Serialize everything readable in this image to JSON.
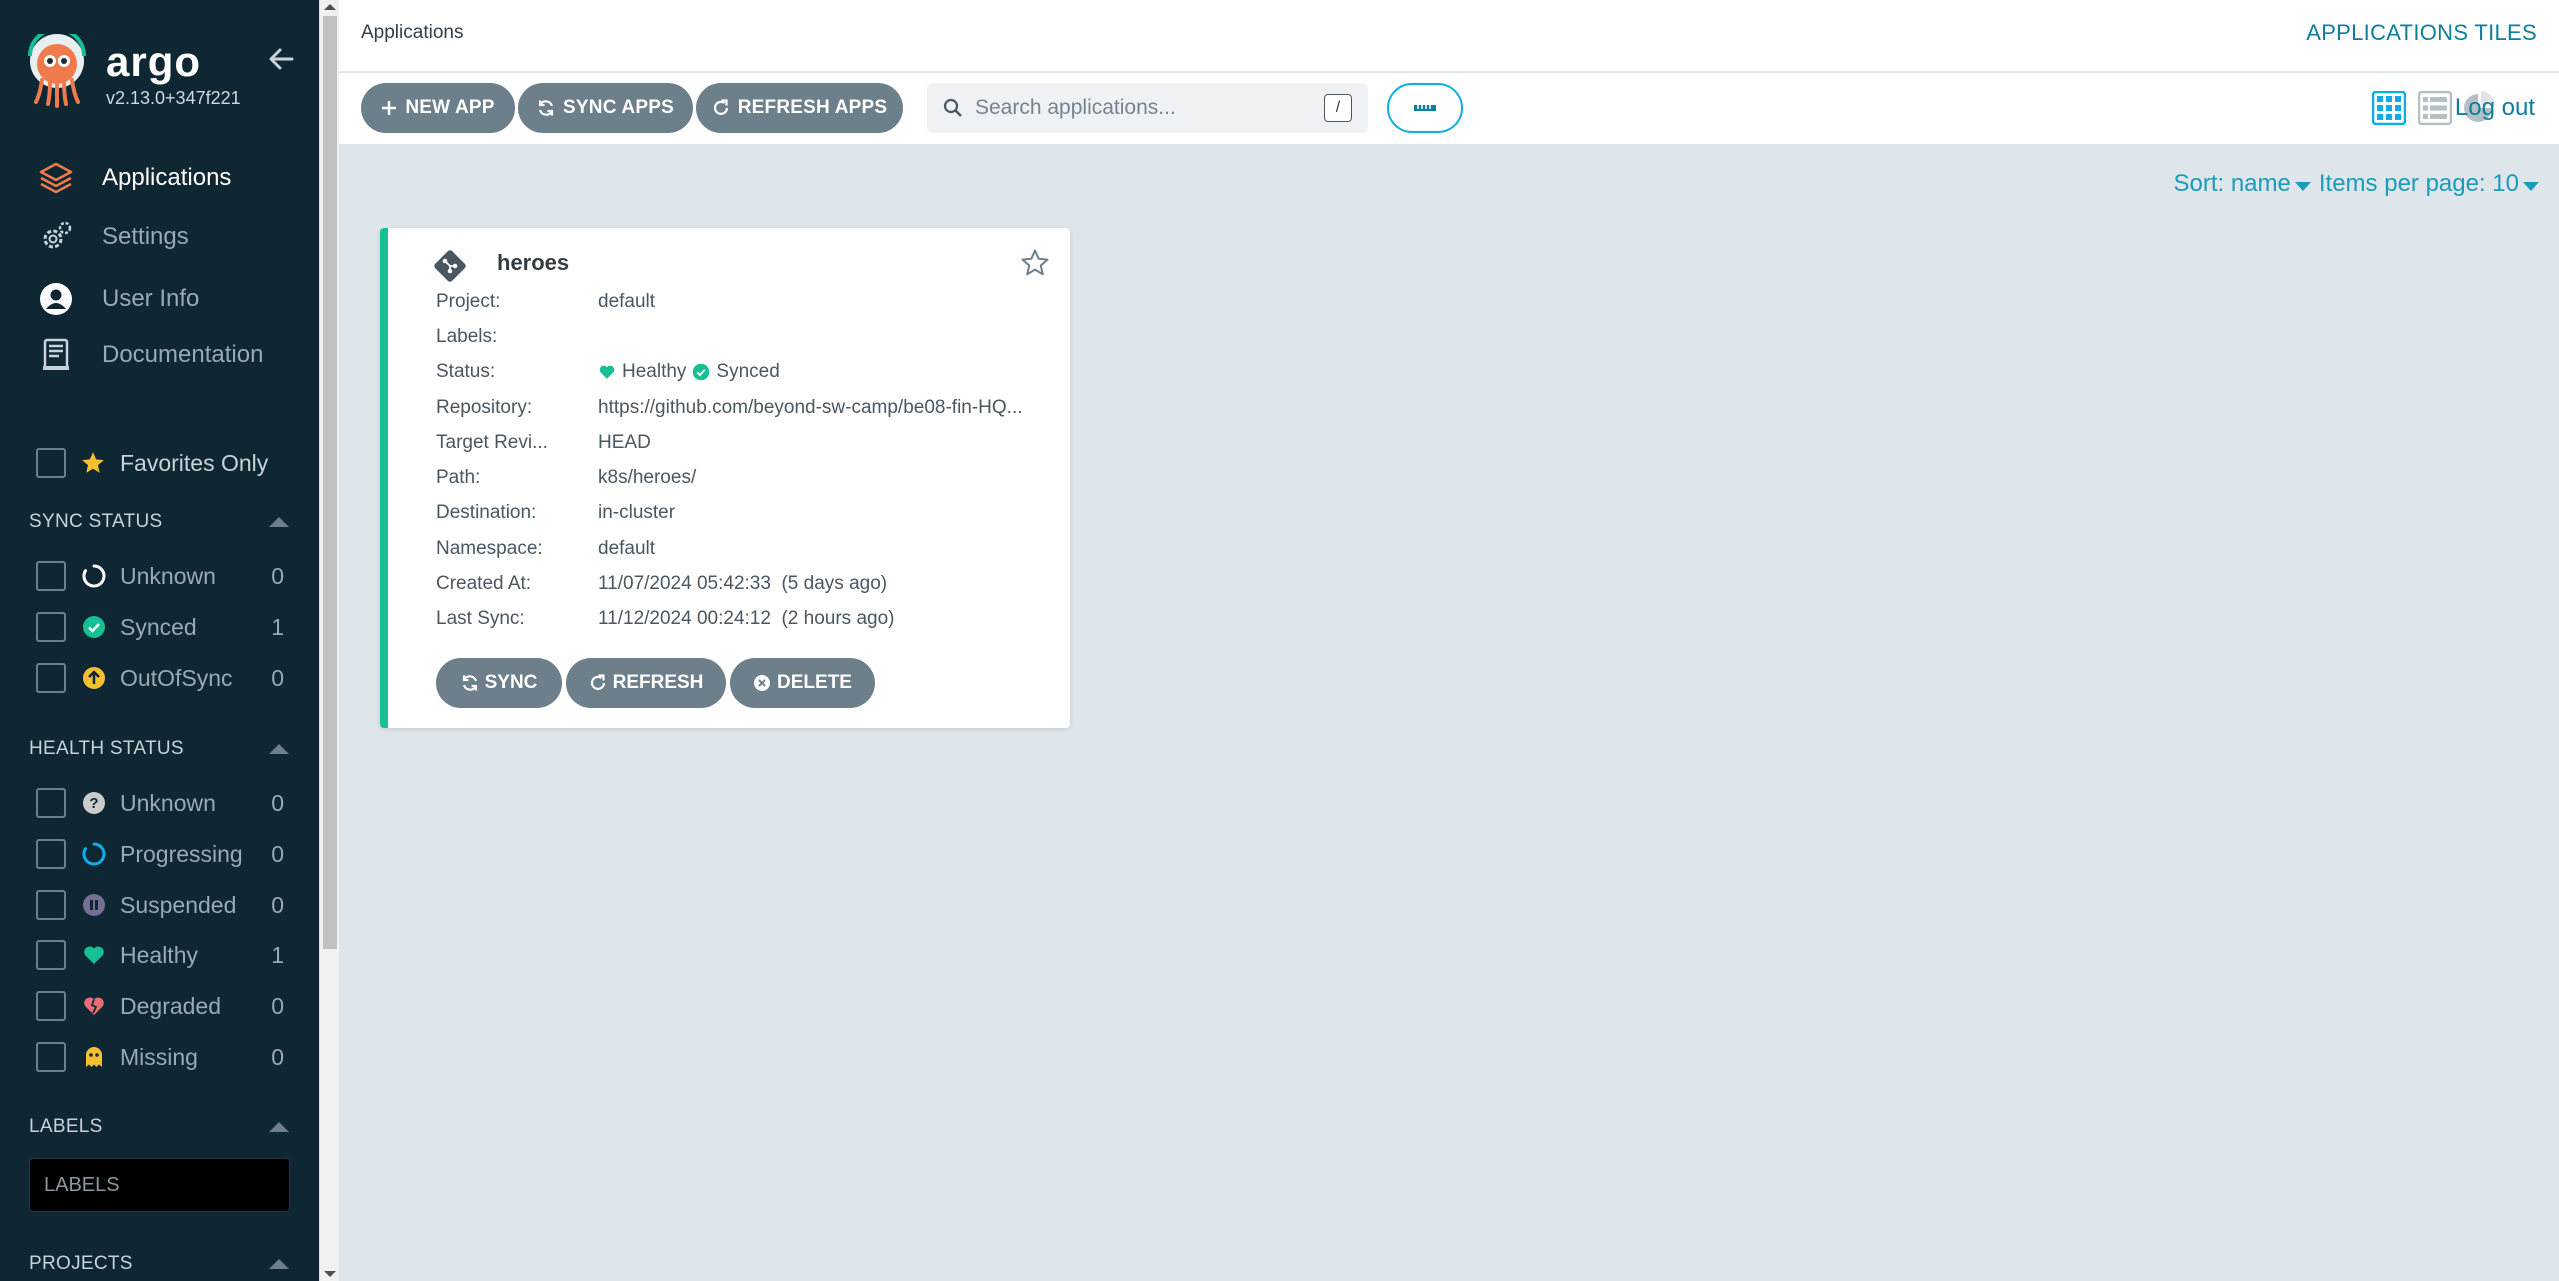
{
  "sidebar": {
    "brand": {
      "name": "argo",
      "version": "v2.13.0+347f221"
    },
    "nav": [
      {
        "label": "Applications",
        "icon": "layers-icon",
        "active": true
      },
      {
        "label": "Settings",
        "icon": "gears-icon"
      },
      {
        "label": "User Info",
        "icon": "user-circle-icon"
      },
      {
        "label": "Documentation",
        "icon": "book-icon"
      }
    ],
    "favorites_label": "Favorites Only",
    "sync_status": {
      "title": "SYNC STATUS",
      "items": [
        {
          "label": "Unknown",
          "count": "0",
          "icon": "circle-notch-icon",
          "color": "#ffffff"
        },
        {
          "label": "Synced",
          "count": "1",
          "icon": "check-circle-icon",
          "color": "#18be94"
        },
        {
          "label": "OutOfSync",
          "count": "0",
          "icon": "arrow-up-circle-icon",
          "color": "#f4c030"
        }
      ]
    },
    "health_status": {
      "title": "HEALTH STATUS",
      "items": [
        {
          "label": "Unknown",
          "count": "0",
          "icon": "question-circle-icon",
          "color": "#cccccc"
        },
        {
          "label": "Progressing",
          "count": "0",
          "icon": "spinner-icon",
          "color": "#0dadea"
        },
        {
          "label": "Suspended",
          "count": "0",
          "icon": "pause-circle-icon",
          "color": "#766f94"
        },
        {
          "label": "Healthy",
          "count": "1",
          "icon": "heart-icon",
          "color": "#18be94"
        },
        {
          "label": "Degraded",
          "count": "0",
          "icon": "heart-broken-icon",
          "color": "#e96d76"
        },
        {
          "label": "Missing",
          "count": "0",
          "icon": "ghost-icon",
          "color": "#f4c030"
        }
      ]
    },
    "labels": {
      "title": "LABELS",
      "placeholder": "LABELS"
    },
    "projects": {
      "title": "PROJECTS"
    }
  },
  "header": {
    "breadcrumb": "Applications",
    "page_title": "APPLICATIONS TILES",
    "buttons": {
      "new_app": "NEW APP",
      "sync_apps": "SYNC APPS",
      "refresh_apps": "REFRESH APPS"
    },
    "search": {
      "placeholder": "Search applications...",
      "shortcut": "/"
    },
    "logout": "Log out",
    "colors": {
      "accent": "#0d7e9b",
      "button": "#6d7f8b"
    }
  },
  "sort": {
    "sort_label": "Sort: name",
    "items_per_page": "Items per page: 10"
  },
  "app_card": {
    "name": "heroes",
    "fields": {
      "project": {
        "k": "Project:",
        "v": "default"
      },
      "labels": {
        "k": "Labels:",
        "v": ""
      },
      "status": {
        "k": "Status:",
        "health": "Healthy",
        "sync": "Synced"
      },
      "repository": {
        "k": "Repository:",
        "v": "https://github.com/beyond-sw-camp/be08-fin-HQ..."
      },
      "target": {
        "k": "Target Revi...",
        "v": "HEAD"
      },
      "path": {
        "k": "Path:",
        "v": "k8s/heroes/"
      },
      "destination": {
        "k": "Destination:",
        "v": "in-cluster"
      },
      "namespace": {
        "k": "Namespace:",
        "v": "default"
      },
      "created": {
        "k": "Created At:",
        "v": "11/07/2024 05:42:33  (5 days ago)"
      },
      "last_sync": {
        "k": "Last Sync:",
        "v": "11/12/2024 00:24:12  (2 hours ago)"
      }
    },
    "actions": {
      "sync": "SYNC",
      "refresh": "REFRESH",
      "delete": "DELETE"
    },
    "border_color": "#18be94"
  }
}
